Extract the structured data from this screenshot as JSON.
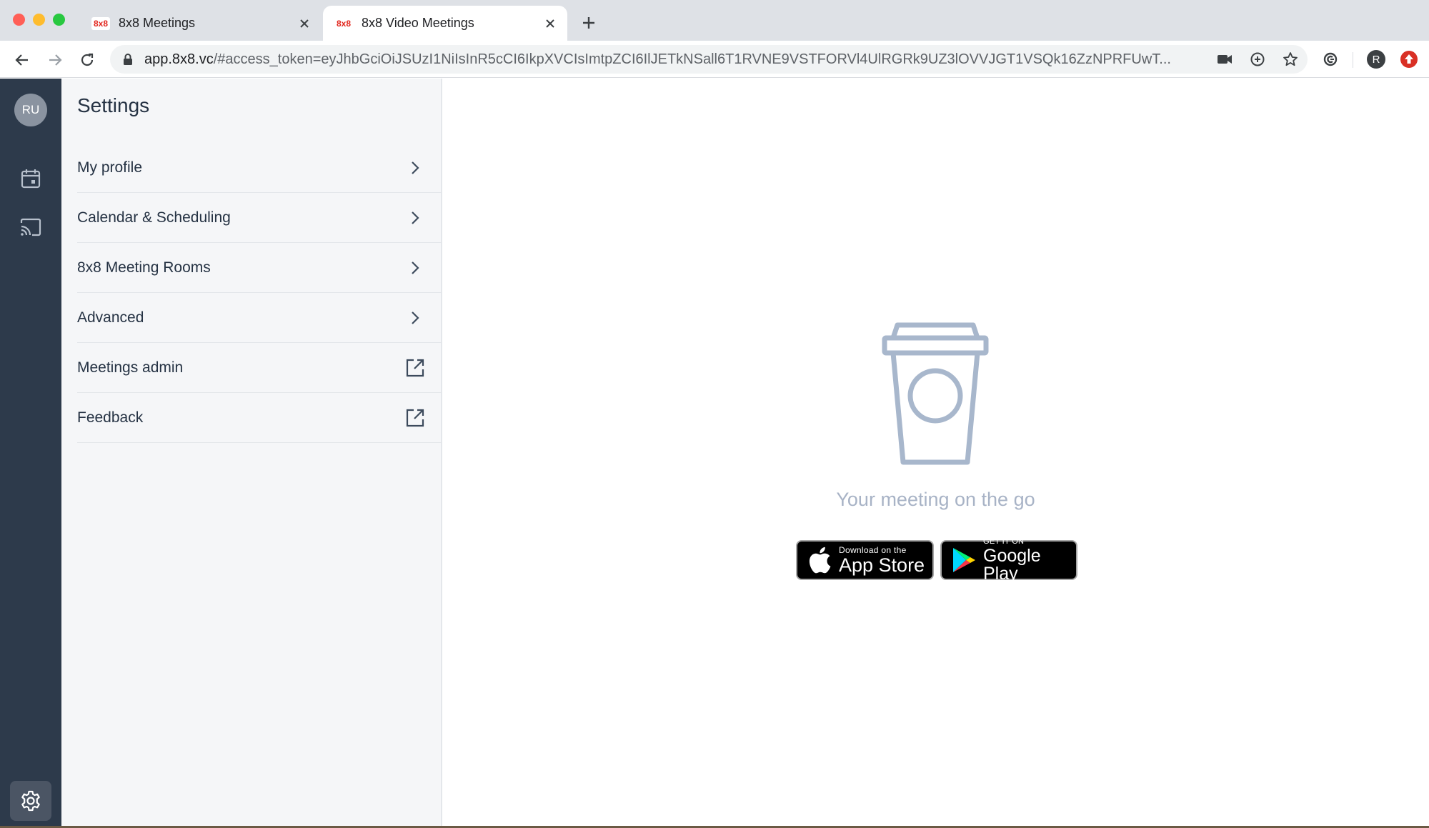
{
  "browser": {
    "tabs": [
      {
        "favicon": "8x8",
        "title": "8x8 Meetings",
        "active": false
      },
      {
        "favicon": "8x8",
        "title": "8x8 Video Meetings",
        "active": true
      }
    ],
    "url_host": "app.8x8.vc",
    "url_rest": "/#access_token=eyJhbGciOiJSUzI1NiIsInR5cCI6IkpXVCIsImtpZCI6IlJETkNSall6T1RVNE9VSTFORVl4UlRGRk9UZ3lOVVJGT1VSQk16ZzNPRFUwT...",
    "profile_initial": "R",
    "icons": {
      "back": "arrow-left-icon",
      "forward": "arrow-right-icon",
      "reload": "reload-icon",
      "lock": "lock-icon",
      "camera": "camera-icon",
      "zoom": "zoom-icon",
      "star": "star-icon",
      "extension": "extension-icon",
      "update": "update-icon"
    }
  },
  "rail": {
    "avatar_initials": "RU",
    "icons": [
      "calendar-icon",
      "cast-icon",
      "gear-icon"
    ]
  },
  "settings": {
    "title": "Settings",
    "items": [
      {
        "label": "My profile",
        "icon": "chevron-right-icon"
      },
      {
        "label": "Calendar & Scheduling",
        "icon": "chevron-right-icon"
      },
      {
        "label": "8x8 Meeting Rooms",
        "icon": "chevron-right-icon"
      },
      {
        "label": "Advanced",
        "icon": "chevron-right-icon"
      },
      {
        "label": "Meetings admin",
        "icon": "external-link-icon"
      },
      {
        "label": "Feedback",
        "icon": "external-link-icon"
      }
    ]
  },
  "main": {
    "illustration": "coffee-cup-icon",
    "tagline": "Your meeting on the go",
    "app_store": {
      "small": "Download on the",
      "big": "App Store"
    },
    "google_play": {
      "small": "GET IT ON",
      "big": "Google Play"
    }
  },
  "colors": {
    "rail_bg": "#2d3a4b",
    "panel_bg": "#f5f6f8",
    "text": "#253243",
    "muted": "#a8b3c6",
    "brand_red": "#e2261d"
  }
}
